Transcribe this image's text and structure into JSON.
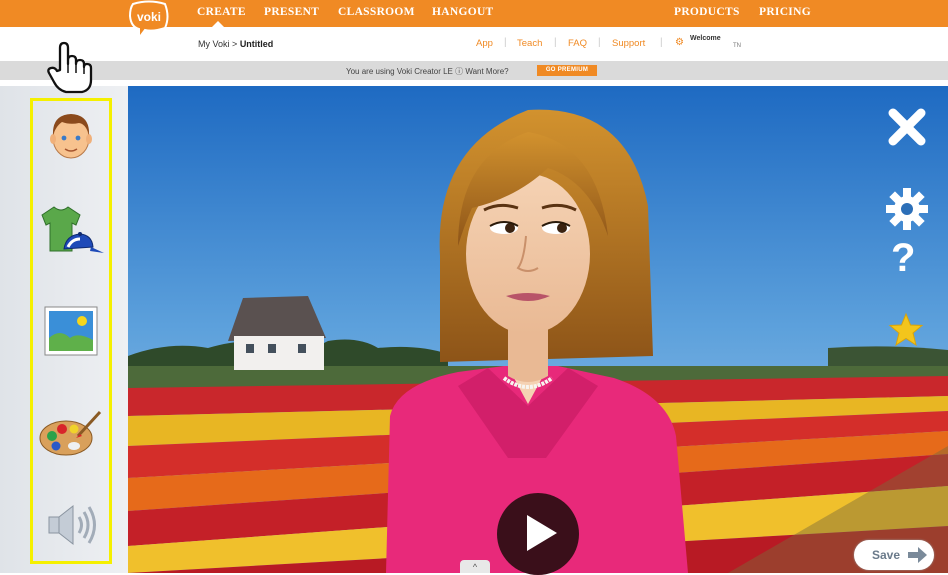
{
  "logo": {
    "text": "voki"
  },
  "nav": {
    "create": "CREATE",
    "present": "PRESENT",
    "classroom": "CLASSROOM",
    "hangout": "HANGOUT",
    "products": "PRODUCTS",
    "pricing": "PRICING"
  },
  "breadcrumb": {
    "root": "My Voki",
    "separator": ">",
    "current": "Untitled"
  },
  "sublinks": {
    "app": "App",
    "teach": "Teach",
    "faq": "FAQ",
    "support": "Support",
    "divider": "|"
  },
  "welcome": {
    "label": "Welcome",
    "user": "TN"
  },
  "promo": {
    "text": "You are using Voki Creator LE ⓘ Want More?",
    "button": "GO PREMIUM"
  },
  "toolbar_icons": [
    "character-face-icon",
    "clothing-icon",
    "background-image-icon",
    "color-palette-icon",
    "speaker-icon"
  ],
  "stage": {
    "right_icons": [
      "close-icon",
      "gear-icon",
      "help-icon",
      "star-icon"
    ],
    "help_label": "?",
    "save_label": "Save",
    "collapse_label": "^"
  },
  "colors": {
    "accent": "#f08a24",
    "highlight": "#f5f000",
    "play": "#3a0f1a"
  }
}
